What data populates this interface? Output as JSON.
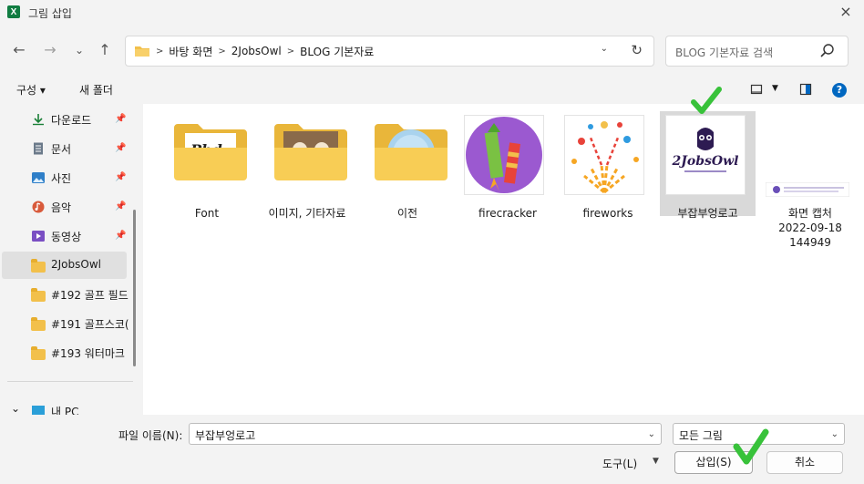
{
  "window": {
    "title": "그림 삽입",
    "app_icon": "excel-icon",
    "close": "×"
  },
  "nav": {
    "back": "←",
    "forward": "→",
    "recent": "⌄",
    "up": "↑"
  },
  "address": {
    "crumbs": [
      "바탕 화면",
      "2JobsOwl",
      "BLOG 기본자료"
    ],
    "separator": ">"
  },
  "search": {
    "placeholder": "BLOG 기본자료 검색"
  },
  "toolbar": {
    "organize": "구성 ▾",
    "new_folder": "새 폴더",
    "help": "?"
  },
  "sidebar": {
    "items": [
      {
        "label": "다운로드",
        "icon": "download-icon",
        "pinned": true
      },
      {
        "label": "문서",
        "icon": "document-icon",
        "pinned": true
      },
      {
        "label": "사진",
        "icon": "pictures-icon",
        "pinned": true
      },
      {
        "label": "음악",
        "icon": "music-icon",
        "pinned": true
      },
      {
        "label": "동영상",
        "icon": "video-icon",
        "pinned": true
      },
      {
        "label": "2JobsOwl",
        "icon": "folder-icon",
        "pinned": false,
        "selected": true
      },
      {
        "label": "#192 골프 필드",
        "icon": "folder-icon",
        "pinned": false
      },
      {
        "label": "#191 골프스코(",
        "icon": "folder-icon",
        "pinned": false
      },
      {
        "label": "#193 워터마크",
        "icon": "folder-icon",
        "pinned": false
      }
    ],
    "this_pc": {
      "label": "내 PC",
      "chevron": "⌄"
    }
  },
  "files": [
    {
      "name": "Font",
      "type": "folder",
      "preview": "Font"
    },
    {
      "name": "이미지, 기타자료",
      "type": "folder"
    },
    {
      "name": "이전",
      "type": "folder"
    },
    {
      "name": "firecracker",
      "type": "image"
    },
    {
      "name": "fireworks",
      "type": "image"
    },
    {
      "name": "부잡부엉로고",
      "type": "image",
      "selected": true,
      "logo_text": "2JobsOwl"
    },
    {
      "name": "화면 캡처 2022-09-18 144949",
      "line1": "화면 캡처",
      "line2": "2022-09-18",
      "line3": "144949",
      "type": "image"
    }
  ],
  "footer": {
    "file_name_label": "파일 이름(N):",
    "file_name_value": "부잡부엉로고",
    "file_type": "모든 그림",
    "tools": "도구(L)",
    "insert": "삽입(S)",
    "cancel": "취소"
  },
  "colors": {
    "accent": "#0067c0",
    "folder": "#f8c94e",
    "check": "#38c23a",
    "excel": "#107c41"
  }
}
